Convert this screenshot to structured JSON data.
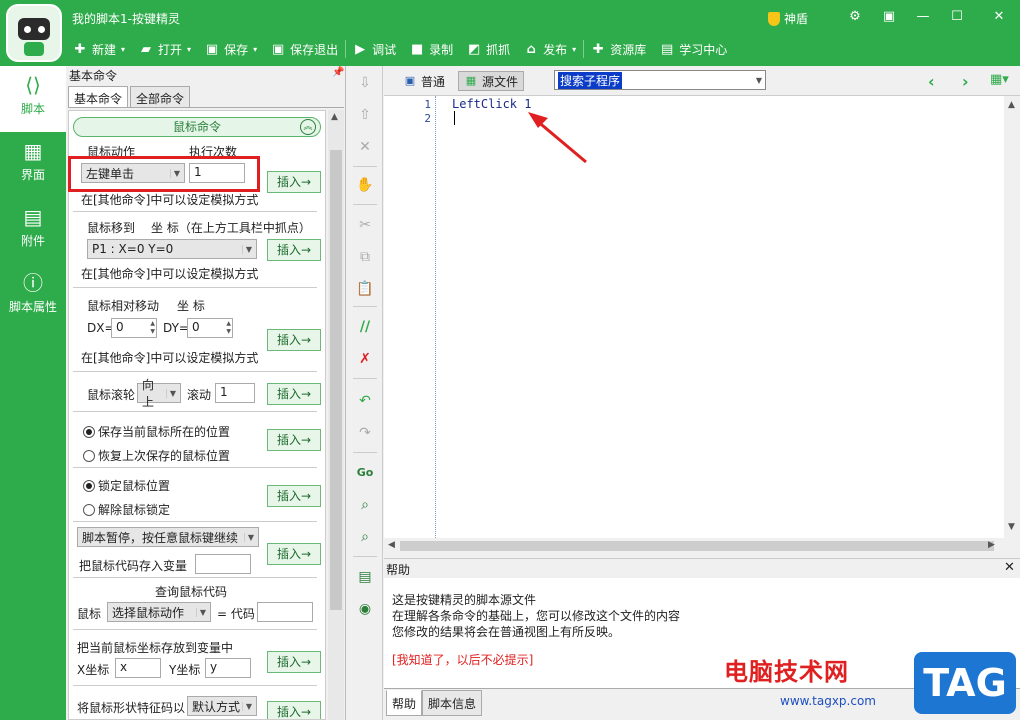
{
  "window": {
    "title": "我的脚本1-按键精灵",
    "shield_label": "神盾"
  },
  "toolbar": [
    {
      "icon": "plus-icon",
      "label": "新建",
      "dropdown": true
    },
    {
      "icon": "folder-icon",
      "label": "打开",
      "dropdown": true
    },
    {
      "icon": "save-icon",
      "label": "保存",
      "dropdown": true
    },
    {
      "icon": "save-exit-icon",
      "label": "保存退出",
      "dropdown": false
    },
    {
      "icon": "debug-icon",
      "label": "调试",
      "dropdown": false
    },
    {
      "icon": "record-icon",
      "label": "录制",
      "dropdown": false
    },
    {
      "icon": "capture-icon",
      "label": "抓抓",
      "dropdown": false
    },
    {
      "icon": "publish-icon",
      "label": "发布",
      "dropdown": true
    },
    {
      "icon": "resource-icon",
      "label": "资源库",
      "dropdown": false
    },
    {
      "icon": "learn-icon",
      "label": "学习中心",
      "dropdown": false
    }
  ],
  "nav": [
    {
      "icon": "script-icon",
      "label": "脚本"
    },
    {
      "icon": "ui-icon",
      "label": "界面"
    },
    {
      "icon": "attachment-icon",
      "label": "附件"
    },
    {
      "icon": "info-icon",
      "label": "脚本属性"
    }
  ],
  "panel": {
    "header": "基本命令",
    "tabs": [
      "基本命令",
      "全部命令"
    ],
    "group_title": "鼠标命令",
    "insert_label": "插入→",
    "mouse_action": {
      "label": "鼠标动作",
      "count_label": "执行次数",
      "value": "左键单击",
      "count": "1",
      "hint": "在[其他命令]中可以设定模拟方式"
    },
    "mouse_move": {
      "label": "鼠标移到",
      "coord_label": "坐 标（在上方工具栏中抓点）",
      "value": "P1 : X=0 Y=0",
      "hint": "在[其他命令]中可以设定模拟方式"
    },
    "mouse_rel": {
      "label": "鼠标相对移动",
      "coord_label": "坐 标",
      "dx_label": "DX=",
      "dx": "0",
      "dy_label": "DY=",
      "dy": "0",
      "hint": "在[其他命令]中可以设定模拟方式"
    },
    "wheel": {
      "label": "鼠标滚轮",
      "dir": "向上",
      "scroll_label": "滚动",
      "scroll": "1"
    },
    "save_pos": {
      "opt1": "保存当前鼠标所在的位置",
      "opt2": "恢复上次保存的鼠标位置"
    },
    "lock": {
      "opt1": "锁定鼠标位置",
      "opt2": "解除鼠标锁定"
    },
    "pause": {
      "value": "脚本暂停，按任意鼠标键继续",
      "store_label": "把鼠标代码存入变量"
    },
    "query": {
      "title": "查询鼠标代码",
      "mouse_label": "鼠标",
      "value": "选择鼠标动作",
      "code_label": "= 代码"
    },
    "store_pos": {
      "label": "把当前鼠标坐标存放到变量中",
      "x_label": "X坐标",
      "x": "x",
      "y_label": "Y坐标",
      "y": "y"
    },
    "shape": {
      "label": "将鼠标形状特征码以",
      "value": "默认方式"
    }
  },
  "editor": {
    "view_tabs": [
      "普通",
      "源文件"
    ],
    "search_placeholder": "搜索子程序",
    "lines": [
      {
        "n": "1",
        "code": "LeftClick 1"
      },
      {
        "n": "2",
        "code": ""
      }
    ]
  },
  "help": {
    "title": "帮助",
    "lines": [
      "这是按键精灵的脚本源文件",
      "在理解各条命令的基础上，您可以修改这个文件的内容",
      "您修改的结果将会在普通视图上有所反映。"
    ],
    "dismiss": "[我知道了，以后不必提示]",
    "tabs": [
      "帮助",
      "脚本信息"
    ]
  },
  "watermark": {
    "site_name": "电脑技术网",
    "url": "www.tagxp.com",
    "tag": "TAG"
  },
  "colors": {
    "brand_green": "#2eab4a",
    "annotation_red": "#e02020",
    "selection_blue": "#0a3cc7"
  }
}
